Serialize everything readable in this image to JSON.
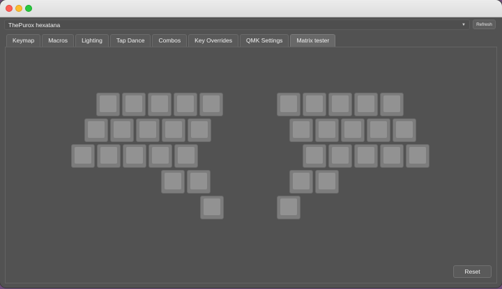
{
  "window": {
    "keyboard_select": {
      "value": "ThePurox hexatana",
      "arrow_icon": "chevron-down-icon"
    },
    "refresh_label": "Refresh"
  },
  "tabs": [
    {
      "label": "Keymap",
      "active": false
    },
    {
      "label": "Macros",
      "active": false
    },
    {
      "label": "Lighting",
      "active": false
    },
    {
      "label": "Tap Dance",
      "active": false
    },
    {
      "label": "Combos",
      "active": false
    },
    {
      "label": "Key Overrides",
      "active": false
    },
    {
      "label": "QMK Settings",
      "active": false
    },
    {
      "label": "Matrix tester",
      "active": true
    }
  ],
  "matrix": {
    "left_half_rows": [
      5,
      5,
      5,
      2,
      1
    ],
    "right_half_rows": [
      5,
      5,
      5,
      2,
      1
    ],
    "pressed_keys": 0
  },
  "reset_label": "Reset",
  "colors": {
    "background": "#525252",
    "key": "#7c7c7c",
    "key_cap": "#929292"
  }
}
